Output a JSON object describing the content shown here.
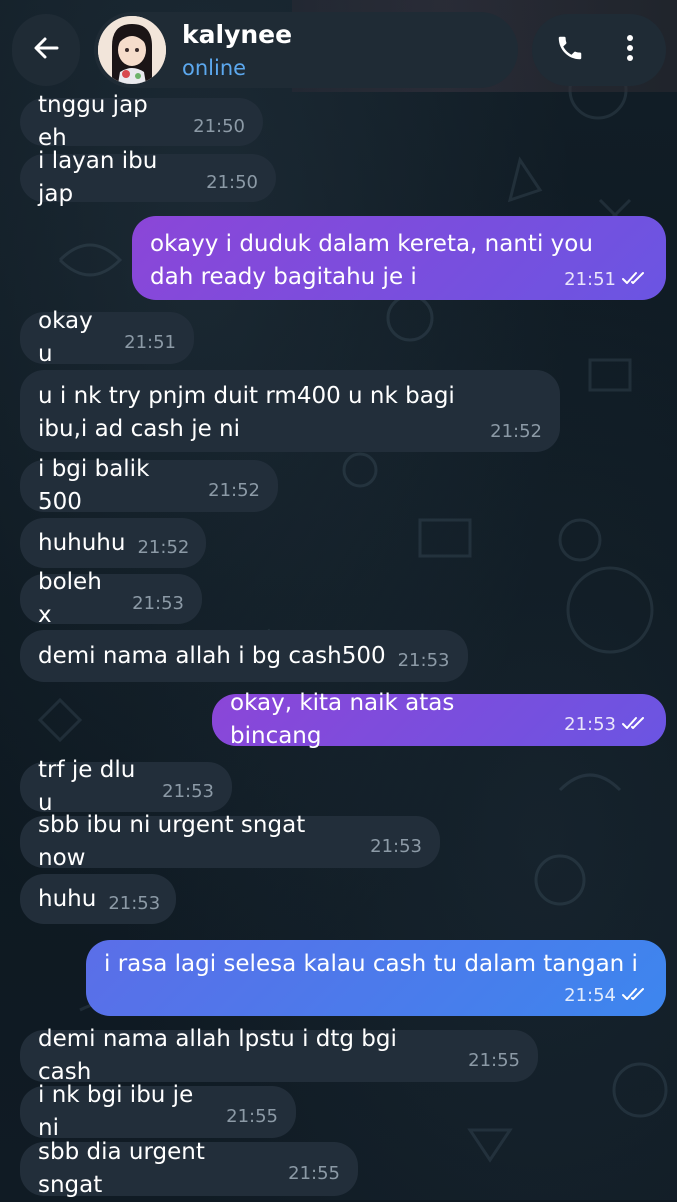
{
  "header": {
    "contact_name": "kalynee",
    "contact_status": "online",
    "back_icon": "arrow-left-icon",
    "call_icon": "phone-icon",
    "menu_icon": "more-vertical-icon"
  },
  "messages": [
    {
      "dir": "in",
      "text": "tnggu jap eh",
      "time": "21:50"
    },
    {
      "dir": "in",
      "text": "i layan ibu jap",
      "time": "21:50"
    },
    {
      "dir": "out",
      "text": "okayy i duduk dalam kereta, nanti you dah ready bagitahu je i",
      "time": "21:51",
      "status": "read"
    },
    {
      "dir": "in",
      "text": "okay u",
      "time": "21:51"
    },
    {
      "dir": "in",
      "text": "u i nk try pnjm duit rm400 u nk bagi ibu,i ad cash je ni",
      "time": "21:52"
    },
    {
      "dir": "in",
      "text": "i bgi balik 500",
      "time": "21:52"
    },
    {
      "dir": "in",
      "text": "huhuhu",
      "time": "21:52"
    },
    {
      "dir": "in",
      "text": "boleh x",
      "time": "21:53"
    },
    {
      "dir": "in",
      "text": "demi nama allah i bg cash500",
      "time": "21:53"
    },
    {
      "dir": "out",
      "text": "okay, kita naik atas bincang",
      "time": "21:53",
      "status": "read"
    },
    {
      "dir": "in",
      "text": "trf je dlu u",
      "time": "21:53"
    },
    {
      "dir": "in",
      "text": "sbb ibu ni urgent sngat now",
      "time": "21:53"
    },
    {
      "dir": "in",
      "text": "huhu",
      "time": "21:53"
    },
    {
      "dir": "out",
      "text": "i rasa lagi selesa kalau cash tu dalam tangan i",
      "time": "21:54",
      "status": "read"
    },
    {
      "dir": "in",
      "text": "demi nama allah lpstu i dtg bgi cash",
      "time": "21:55"
    },
    {
      "dir": "in",
      "text": "i nk bgi ibu je ni",
      "time": "21:55"
    },
    {
      "dir": "in",
      "text": "sbb dia urgent sngat",
      "time": "21:55"
    }
  ],
  "colors": {
    "background": "#0f1922",
    "incoming_bubble": "#222e3a",
    "outgoing_bubble_purple": "#8b46d8",
    "outgoing_bubble_blue": "#3d86ee",
    "status_online": "#5ca8ee",
    "timestamp": "#8c9aa6"
  }
}
